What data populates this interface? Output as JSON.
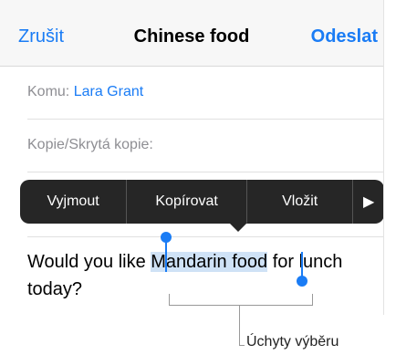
{
  "navbar": {
    "cancel_label": "Zrušit",
    "title": "Chinese food",
    "send_label": "Odeslat"
  },
  "fields": {
    "to_label": "Komu:",
    "to_value": "Lara Grant",
    "cc_label": "Kopie/Skrytá kopie:"
  },
  "edit_menu": {
    "items": [
      "Vyjmout",
      "Kopírovat",
      "Vložit"
    ],
    "more_icon": "right-triangle-icon"
  },
  "message": {
    "before": "Would you like ",
    "selected": "Mandarin food",
    "after": " for lunch today?"
  },
  "annotation": "Úchyty výběru",
  "colors": {
    "accent": "#1a7cf5",
    "menu_bg": "#262626",
    "selection": "#cfe2f6"
  }
}
